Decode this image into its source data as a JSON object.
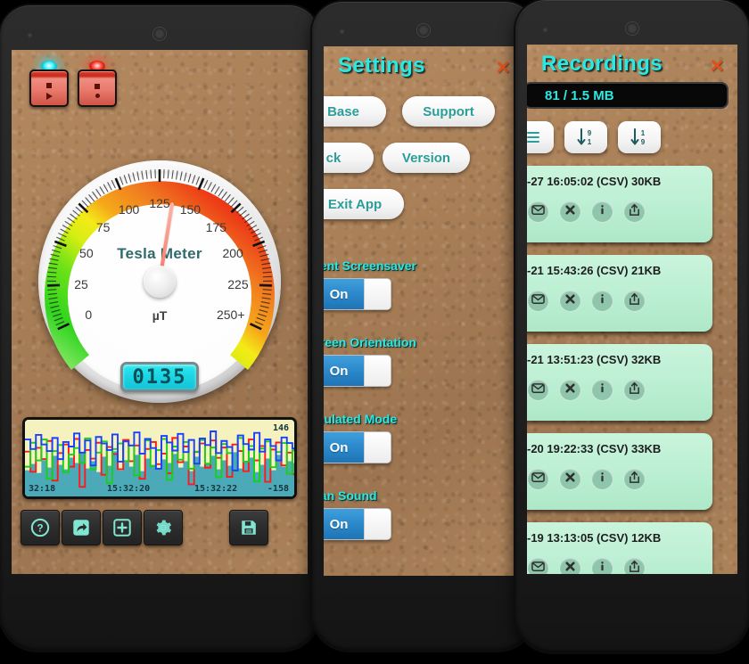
{
  "meter": {
    "gauge_title": "Tesla Meter",
    "unit": "µT",
    "digital_value": "0135",
    "needle_value": 135,
    "scale_labels": [
      "0",
      "25",
      "50",
      "75",
      "100",
      "125",
      "150",
      "175",
      "200",
      "225",
      "250+"
    ],
    "led_buttons": [
      {
        "name": "record-button",
        "led_color": "#2ce8ff",
        "symbols": [
          "square",
          "triangle"
        ]
      },
      {
        "name": "stop-button",
        "led_color": "#ff3b22",
        "symbols": [
          "square",
          "dot"
        ]
      }
    ],
    "toolbar": [
      {
        "label": "help",
        "icon": "question-icon"
      },
      {
        "label": "share",
        "icon": "share-arrow-icon"
      },
      {
        "label": "add",
        "icon": "plus-icon"
      },
      {
        "label": "settings",
        "icon": "gear-icon"
      }
    ],
    "save_button": {
      "label": "save",
      "icon": "floppy-disk-icon"
    },
    "chart_data": {
      "type": "line",
      "title": "",
      "xlabel": "",
      "ylabel": "",
      "max_label": "146",
      "min_label": "-158",
      "ylim": [
        -158,
        146
      ],
      "time_ticks": [
        "32:18",
        "15:32:20",
        "15:32:22"
      ],
      "grid": false,
      "legend": "none",
      "background": "#f6f2c0",
      "bar_color": "#4ba9b8",
      "series": [
        {
          "name": "magnitude",
          "color": "#4ba9b8",
          "render": "bars",
          "values": [
            58,
            72,
            52,
            80,
            64,
            90,
            70,
            60,
            86,
            74,
            96,
            62,
            78,
            54,
            88,
            68,
            100,
            58,
            76,
            66,
            92,
            56,
            84,
            70,
            60,
            82,
            74,
            94,
            64,
            78,
            56,
            88,
            66,
            72,
            90,
            60,
            80,
            68,
            98,
            62,
            76,
            86,
            54,
            70,
            84,
            58,
            92,
            66,
            78,
            74
          ]
        },
        {
          "name": "x-axis",
          "color": "#ff1a1a",
          "render": "step",
          "values": [
            20,
            -60,
            35,
            -10,
            62,
            -95,
            14,
            48,
            -40,
            70,
            -120,
            26,
            -8,
            55,
            -72,
            38,
            10,
            -50,
            66,
            -18,
            44,
            -88,
            30,
            58,
            -30,
            12,
            -66,
            74,
            -22,
            40,
            -110,
            18,
            52,
            -44,
            64,
            -5,
            36,
            -80,
            48,
            22,
            -58,
            68,
            -15,
            42,
            -100,
            28,
            56,
            -35,
            16,
            -70
          ]
        },
        {
          "name": "y-axis",
          "color": "#17d117",
          "render": "step",
          "values": [
            -40,
            55,
            -15,
            68,
            -88,
            22,
            46,
            -62,
            8,
            34,
            -25,
            72,
            -50,
            16,
            60,
            -105,
            30,
            52,
            -18,
            44,
            -75,
            12,
            64,
            -38,
            26,
            70,
            -92,
            40,
            -12,
            58,
            -48,
            20,
            66,
            -28,
            36,
            -82,
            50,
            14,
            -56,
            74,
            -20,
            42,
            -98,
            32,
            60,
            -42,
            18,
            54,
            -68,
            24
          ]
        },
        {
          "name": "z-axis",
          "color": "#1a3fff",
          "render": "step",
          "values": [
            68,
            30,
            86,
            48,
            22,
            74,
            -10,
            58,
            40,
            92,
            16,
            64,
            -35,
            78,
            52,
            26,
            88,
            -20,
            60,
            44,
            96,
            12,
            70,
            34,
            -48,
            82,
            56,
            24,
            90,
            18,
            66,
            -28,
            72,
            46,
            100,
            14,
            62,
            38,
            -55,
            84,
            50,
            28,
            94,
            20,
            68,
            42,
            -15,
            76,
            54,
            32
          ]
        }
      ]
    }
  },
  "settings": {
    "title": "Settings",
    "close": "×",
    "buttons": [
      {
        "label": "Base"
      },
      {
        "label": "Support"
      },
      {
        "label": "ck"
      },
      {
        "label": "Version"
      },
      {
        "label": "Exit App"
      }
    ],
    "switches": [
      {
        "label": "vent Screensaver",
        "state": "On"
      },
      {
        "label": "creen Orientation",
        "state": "On"
      },
      {
        "label": "mulated Mode",
        "state": "On"
      },
      {
        "label": "can Sound",
        "state": "On"
      }
    ]
  },
  "recordings": {
    "title": "Recordings",
    "close": "×",
    "counter": "81 / 1.5 MB",
    "sort_buttons": [
      {
        "name": "sort-descending-button",
        "glyph": "↓",
        "top": "9",
        "bottom": "1"
      },
      {
        "name": "sort-ascending-button",
        "glyph": "↓",
        "top": "1",
        "bottom": "9"
      }
    ],
    "row_icons": [
      "email-icon",
      "delete-icon",
      "info-icon",
      "share-icon"
    ],
    "items": [
      {
        "name": "-27 16:05:02 (CSV) 30KB"
      },
      {
        "name": "-21 15:43:26 (CSV) 21KB"
      },
      {
        "name": "-21 13:51:23 (CSV) 32KB"
      },
      {
        "name": "-20 19:22:33 (CSV) 33KB"
      },
      {
        "name": "-19 13:13:05 (CSV) 12KB"
      }
    ]
  }
}
